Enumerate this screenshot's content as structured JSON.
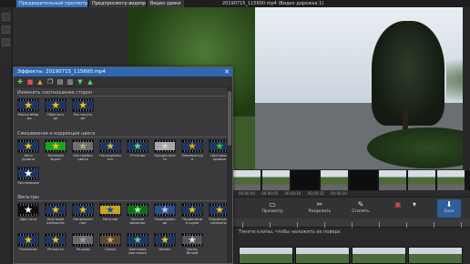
{
  "window": {
    "tabs": [
      {
        "label": "Предварительный просмотр клипа",
        "active": true
      },
      {
        "label": "Предпросмотр видеоряда",
        "active": false
      },
      {
        "label": "Видео уроки",
        "active": false
      }
    ],
    "document_title": "20190715_115600.mp4 (Видео дорожка 1)"
  },
  "dialog": {
    "title": "Эффекты: 20190715_115600.mp4",
    "close": "✕",
    "toolbar_icons": [
      "add-icon",
      "remove-icon",
      "move-up-icon",
      "copy-icon",
      "save-icon",
      "open-icon",
      "down-icon",
      "up-icon"
    ],
    "sections": [
      {
        "title": "Изменить соотношение сторон",
        "effects": [
          {
            "label": "Масштабир. до сохранения соотношения",
            "tile": "#1f3660",
            "glyph": "★",
            "glyph_color": "#f2c40c"
          },
          {
            "label": "Обрезать до соотношения",
            "tile": "#1f3660",
            "glyph": "★",
            "glyph_color": "#f2c40c"
          },
          {
            "label": "Растянуть до соотношения",
            "tile": "#1f3660",
            "glyph": "★",
            "glyph_color": "#f2c40c"
          }
        ]
      },
      {
        "title": "Смешивание и коррекция цвета",
        "effects": [
          {
            "label": "Авто уровни",
            "tile": "#1f3660",
            "glyph": "★",
            "glyph_color": "#f2c40c"
          },
          {
            "label": "Зеленый экран",
            "tile": "#1aa51a",
            "glyph": "★",
            "glyph_color": "#f2c40c"
          },
          {
            "label": "Настройки цвета",
            "tile": "#6e6e6e",
            "glyph": "★",
            "glyph_color": "#b9a979"
          },
          {
            "label": "Насыщенность",
            "tile": "#1f3660",
            "glyph": "★",
            "glyph_color": "#d4b84a"
          },
          {
            "label": "Оттенки",
            "tile": "#1f3660",
            "glyph": "★",
            "glyph_color": "#5fd38a"
          },
          {
            "label": "Прозрачность",
            "tile": "#a8a8a8",
            "glyph": "★",
            "glyph_color": "#cfcfcf"
          },
          {
            "label": "Температура",
            "tile": "#1f3660",
            "glyph": "★",
            "glyph_color": "#f29a0c"
          },
          {
            "label": "Цветовые кривые",
            "tile": "#1f3660",
            "glyph": "★",
            "glyph_color": "#34c734"
          },
          {
            "label": "Экспозиция",
            "tile": "#1f3660",
            "glyph": "★",
            "glyph_color": "#ffffff"
          }
        ]
      },
      {
        "title": "Фильтры",
        "effects": [
          {
            "label": "Два тона",
            "tile": "#0e0e0e",
            "glyph": "★",
            "glyph_color": "#ffffff"
          },
          {
            "label": "Круговое размытие",
            "tile": "#1f3660",
            "glyph": "★",
            "glyph_color": "#f2c40c"
          },
          {
            "label": "Направленное размытие",
            "tile": "#1f3660",
            "glyph": "★",
            "glyph_color": "#f2c40c"
          },
          {
            "label": "Негатив",
            "tile": "#c4a820",
            "glyph": "★",
            "glyph_color": "#1e4a9e"
          },
          {
            "label": "Ночное видение",
            "tile": "#0f6d1e",
            "glyph": "★",
            "glyph_color": "#9dff9d"
          },
          {
            "label": "Окрашивание",
            "tile": "#2b4f8c",
            "glyph": "★",
            "glyph_color": "#b6c8ec"
          },
          {
            "label": "Подавление шума",
            "tile": "#1f3660",
            "glyph": "★",
            "glyph_color": "#f2c40c"
          },
          {
            "label": "Радиальное размытие",
            "tile": "#1f3660",
            "glyph": "★",
            "glyph_color": "#f2c40c"
          },
          {
            "label": "Размытие",
            "tile": "#1f3660",
            "glyph": "★",
            "glyph_color": "#f2c40c"
          },
          {
            "label": "Резкость",
            "tile": "#1f3660",
            "glyph": "★",
            "glyph_color": "#f2c40c"
          },
          {
            "label": "Рельеф",
            "tile": "#6a6a6a",
            "glyph": "★",
            "glyph_color": "#9a9a9a"
          },
          {
            "label": "Сепия",
            "tile": "#5e4a2a",
            "glyph": "★",
            "glyph_color": "#c9a66a"
          },
          {
            "label": "Цветовая растяжка",
            "tile": "#1f3660",
            "glyph": "★",
            "glyph_color": "#5fd38a"
          },
          {
            "label": "Шепот",
            "tile": "#1f3660",
            "glyph": "★",
            "glyph_color": "#f2c40c"
          },
          {
            "label": "Черно-белый",
            "tile": "#555555",
            "glyph": "★",
            "glyph_color": "#dddddd"
          }
        ]
      }
    ]
  },
  "timeline": {
    "timecodes": [
      "00:00:00",
      "00:00:05",
      "00:00:10",
      "00:00:15",
      "00:00:20"
    ],
    "buttons": [
      {
        "label": "Просмотр",
        "icon": "monitor-icon",
        "glyph": "▭"
      },
      {
        "label": "Разделить",
        "icon": "scissors-icon",
        "glyph": "✂"
      },
      {
        "label": "Стилять",
        "icon": "pen-icon",
        "glyph": "✎"
      },
      {
        "label": "",
        "icon": "3d-glasses-icon",
        "glyph": "▣"
      },
      {
        "label": "",
        "icon": "dropdown-icon",
        "glyph": "▾"
      },
      {
        "label": "Save",
        "icon": "save-icon",
        "glyph": "⬇"
      }
    ],
    "hint": "Тяните клипы, чтобы наложить их поверх"
  },
  "colors": {
    "accent": "#2f67b0",
    "panel": "#3a3a3c",
    "background": "#2e2e30"
  }
}
